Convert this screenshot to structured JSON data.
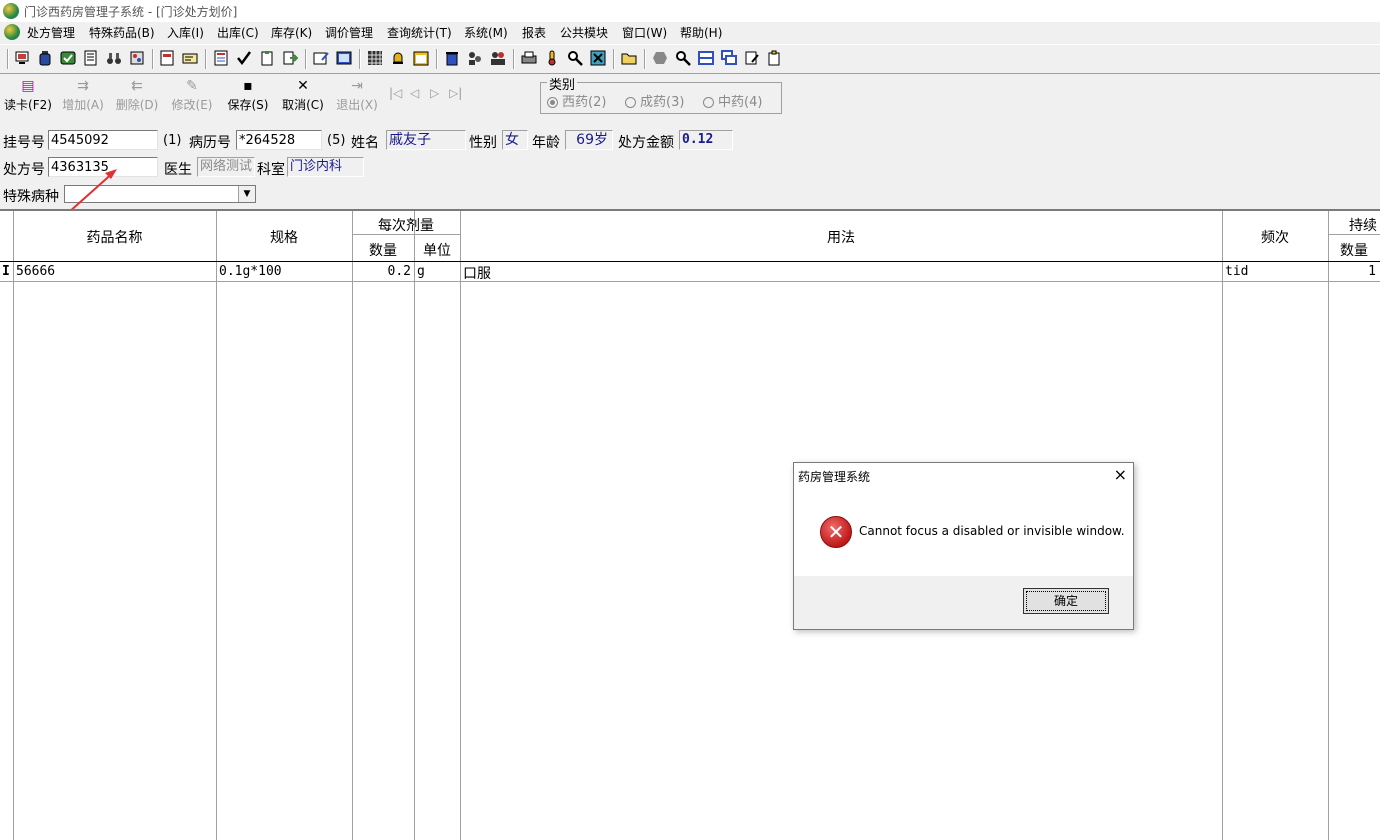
{
  "window": {
    "title": "门诊西药房管理子系统 - [门诊处方划价]"
  },
  "menu": [
    "处方管理",
    "特殊药品(B)",
    "入库(I)",
    "出库(C)",
    "库存(K)",
    "调价管理",
    "查询统计(T)",
    "系统(M)",
    "报表",
    "公共模块",
    "窗口(W)",
    "帮助(H)"
  ],
  "actions": {
    "read_card": "读卡(F2)",
    "add": "增加(A)",
    "delete": "删除(D)",
    "modify": "修改(E)",
    "save": "保存(S)",
    "cancel": "取消(C)",
    "exit": "退出(X)"
  },
  "category": {
    "legend": "类别",
    "options": [
      "西药(2)",
      "成药(3)",
      "中药(4)"
    ],
    "selected": "西药(2)"
  },
  "form": {
    "reg_no_label": "挂号号",
    "reg_no": "4545092",
    "reg_no_hint": "(1)",
    "record_no_label": "病历号",
    "record_no": "*264528",
    "record_no_hint": "(5)",
    "name_label": "姓名",
    "name": "戚友子",
    "sex_label": "性别",
    "sex": "女",
    "age_label": "年龄",
    "age": "69岁",
    "amount_label": "处方金额",
    "amount": "0.12",
    "rx_no_label": "处方号",
    "rx_no": "4363135",
    "doctor_label": "医生",
    "doctor": "网络测试",
    "dept_label": "科室",
    "dept": "门诊内科",
    "special_label": "特殊病种",
    "special": ""
  },
  "grid": {
    "headers": {
      "drug_name": "药品名称",
      "spec": "规格",
      "dose_group": "每次剂量",
      "dose_qty": "数量",
      "dose_unit": "单位",
      "usage": "用法",
      "freq": "频次",
      "cont_group": "持续",
      "cont_qty": "数量"
    },
    "rows": [
      {
        "indicator": "I",
        "drug_name": "56666",
        "spec": "0.1g*100",
        "dose_qty": "0.2",
        "dose_unit": "g",
        "usage": "口服",
        "freq": "tid",
        "cont_qty": "1"
      }
    ]
  },
  "dialog": {
    "title": "药房管理系统",
    "message": "Cannot focus a disabled or invisible window.",
    "ok": "确定",
    "close": "×",
    "icon": "error-icon"
  }
}
